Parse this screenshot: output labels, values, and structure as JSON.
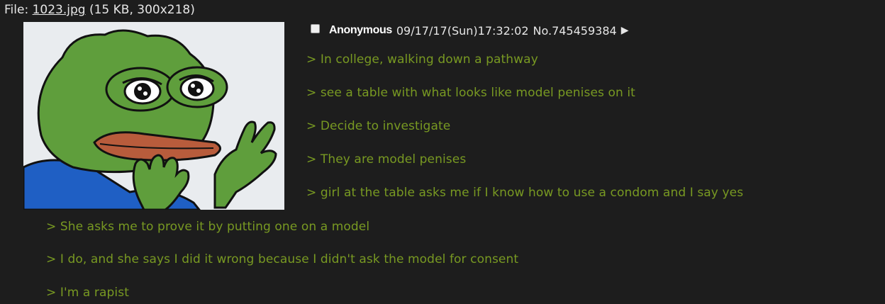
{
  "file": {
    "label": "File:",
    "name": "1023.jpg",
    "meta": "(15 KB, 300x218)"
  },
  "post": {
    "name": "Anonymous",
    "datetime": "09/17/17(Sun)17:32:02",
    "number": "No.745459384",
    "arrow_icon": "play-arrow-icon"
  },
  "lines": [
    "> In college, walking down a pathway",
    "> see a table with what looks like model penises on it",
    "> Decide to investigate",
    "> They are model penises",
    "> girl at the table asks me if I know how to use a condom and I say yes",
    "> She asks me to prove it by putting one on a model",
    "> I do, and she says I did it wrong because I didn't ask the model for consent",
    "> I'm a rapist"
  ],
  "colors": {
    "background": "#1d1d1d",
    "greentext": "#789922",
    "text": "#e6e6e6"
  }
}
